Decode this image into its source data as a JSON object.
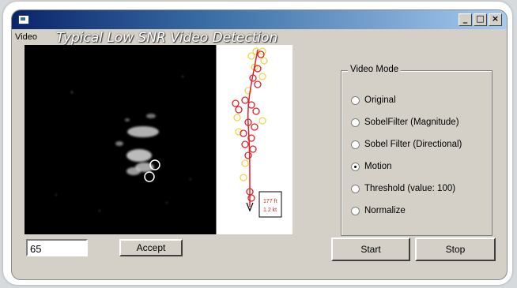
{
  "window": {
    "controls": [
      "_",
      "□",
      "×"
    ]
  },
  "menu": {
    "video_label": "Video"
  },
  "caption": "Typical Low SNR Video Detection",
  "track_annotation": {
    "line1": "177 ft",
    "line2": "1.2 kt"
  },
  "video_mode": {
    "title": "Video Mode",
    "options": [
      {
        "label": "Original",
        "selected": false
      },
      {
        "label": "SobelFilter (Magnitude)",
        "selected": false
      },
      {
        "label": "Sobel Filter (Directional)",
        "selected": false
      },
      {
        "label": "Motion",
        "selected": true
      },
      {
        "label": "Threshold (value: 100)",
        "selected": false
      },
      {
        "label": "Normalize",
        "selected": false
      }
    ]
  },
  "controls": {
    "value_input": "65",
    "accept_label": "Accept",
    "start_label": "Start",
    "stop_label": "Stop"
  },
  "colors": {
    "track_red": "#e0202a",
    "track_yellow": "#f2d648",
    "titlebar_dark": "#0a246a",
    "titlebar_light": "#a6caf0"
  }
}
